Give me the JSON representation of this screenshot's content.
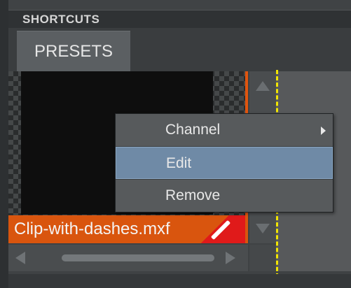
{
  "panel": {
    "title": "SHORTCUTS"
  },
  "tabs": [
    {
      "label": "PRESETS"
    }
  ],
  "clip": {
    "filename": "Clip-with-dashes.mxf"
  },
  "context_menu": {
    "items": [
      {
        "label": "Channel",
        "has_submenu": true
      },
      {
        "label": "Edit",
        "selected": true
      },
      {
        "label": "Remove"
      }
    ]
  },
  "colors": {
    "clip_label_bg": "#d9550e",
    "selection": "#6f8aa6",
    "dashed_guide": "#f2e600",
    "corner_badge": "#e01a1a"
  }
}
